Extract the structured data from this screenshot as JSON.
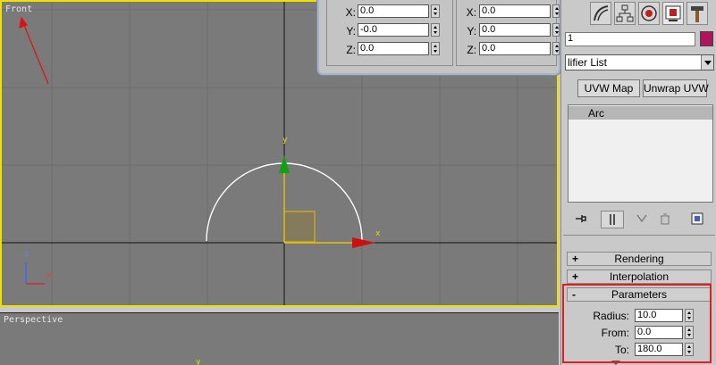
{
  "viewports": {
    "front": {
      "label": "Front",
      "axis_y": "y",
      "axis_x": "x",
      "tripod_z": "z",
      "tripod_x": "x"
    },
    "perspective": {
      "label": "Perspective",
      "axis_y": "y"
    }
  },
  "transform_typein": {
    "absolute": [
      {
        "axis": "X:",
        "value": "0.0"
      },
      {
        "axis": "Y:",
        "value": "-0.0"
      },
      {
        "axis": "Z:",
        "value": "0.0"
      }
    ],
    "offset": [
      {
        "axis": "X:",
        "value": "0.0"
      },
      {
        "axis": "Y:",
        "value": "0.0"
      },
      {
        "axis": "Z:",
        "value": "0.0"
      }
    ]
  },
  "command_panel": {
    "tabs": [
      "motion-icon",
      "hierarchy-icon",
      "display-icon",
      "utilities-icon",
      "hammer-icon"
    ],
    "object_name": "1",
    "object_color": "#b0145a",
    "modifier_list": "lifier List",
    "buttons": {
      "uvw_map": "UVW Map",
      "unwrap_uvw": "Unwrap UVW"
    },
    "stack": [
      "Arc"
    ],
    "rollouts": [
      {
        "sign": "+",
        "label": "Rendering"
      },
      {
        "sign": "+",
        "label": "Interpolation"
      },
      {
        "sign": "-",
        "label": "Parameters"
      }
    ],
    "parameters": [
      {
        "label": "Radius:",
        "value": "10.0"
      },
      {
        "label": "From:",
        "value": "0.0"
      },
      {
        "label": "To:",
        "value": "180.0"
      }
    ]
  }
}
